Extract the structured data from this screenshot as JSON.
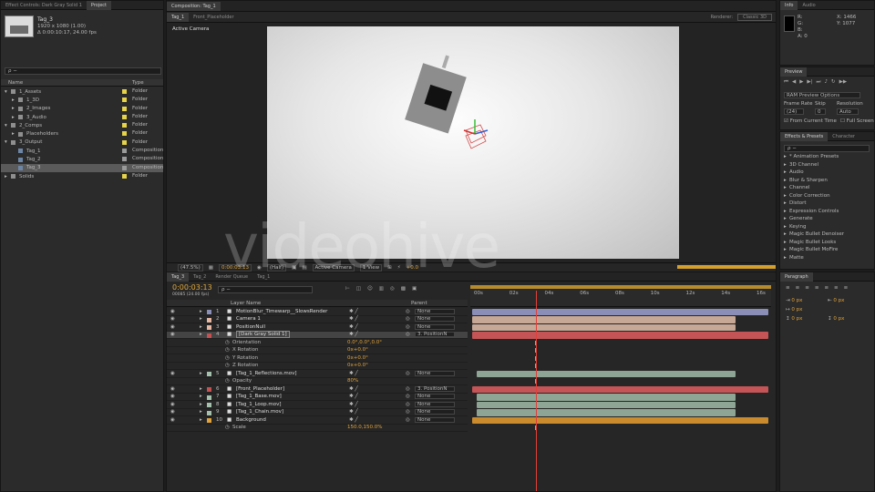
{
  "project": {
    "tabs": [
      "Effect Controls: Dark Gray Solid 1",
      "Project"
    ],
    "comp_name": "Tag_3",
    "comp_info_line1": "1920 x 1080 (1.00)",
    "comp_info_line2": "Δ 0:00:10:17, 24.00 fps",
    "search_placeholder": "ρ −",
    "col_name": "Name",
    "col_type": "Type",
    "items": [
      {
        "name": "1_Assets",
        "type": "Folder",
        "indent": 0,
        "kind": "folder",
        "twirl": "▾"
      },
      {
        "name": "1_3D",
        "type": "Folder",
        "indent": 1,
        "kind": "folder",
        "twirl": "▸"
      },
      {
        "name": "2_Images",
        "type": "Folder",
        "indent": 1,
        "kind": "folder",
        "twirl": "▸"
      },
      {
        "name": "3_Audio",
        "type": "Folder",
        "indent": 1,
        "kind": "folder",
        "twirl": "▸"
      },
      {
        "name": "2_Comps",
        "type": "Folder",
        "indent": 0,
        "kind": "folder",
        "twirl": "▾"
      },
      {
        "name": "Placeholders",
        "type": "Folder",
        "indent": 1,
        "kind": "folder",
        "twirl": "▸"
      },
      {
        "name": "3_Output",
        "type": "Folder",
        "indent": 0,
        "kind": "folder",
        "twirl": "▾"
      },
      {
        "name": "Tag_1",
        "type": "Composition",
        "indent": 1,
        "kind": "comp",
        "twirl": ""
      },
      {
        "name": "Tag_2",
        "type": "Composition",
        "indent": 1,
        "kind": "comp",
        "twirl": ""
      },
      {
        "name": "Tag_3",
        "type": "Composition",
        "indent": 1,
        "kind": "comp",
        "twirl": "",
        "selected": true
      },
      {
        "name": "Solids",
        "type": "Folder",
        "indent": 0,
        "kind": "folder",
        "twirl": "▸"
      }
    ]
  },
  "composition": {
    "tabs": [
      "Composition: Tag_1",
      "Tag_1",
      "Front_Placeholder"
    ],
    "renderer_label": "Renderer:",
    "renderer_value": "Classic 3D",
    "view_label": "Active Camera",
    "zoom": "(47.5%)",
    "timecode": "0:00:03:13",
    "resolution": "(Half)",
    "camera": "Active Camera",
    "views": "1 View",
    "exposure": "+0.0",
    "watermark": "videohive"
  },
  "info": {
    "tabs": [
      "Info",
      "Audio"
    ],
    "r": "R:",
    "g": "G:",
    "b": "B:",
    "a": "A: 0",
    "x": "X: 1466",
    "y": "Y: 1077"
  },
  "preview": {
    "title": "Preview",
    "ram_options": "RAM Preview Options",
    "frame_rate_label": "Frame Rate",
    "skip_label": "Skip",
    "resolution_label": "Resolution",
    "frame_rate": "(24)",
    "skip": "0",
    "resolution": "Auto",
    "from_current": "From Current Time",
    "full_screen": "Full Screen"
  },
  "effects": {
    "tabs": [
      "Effects & Presets",
      "Character"
    ],
    "search_placeholder": "ρ −",
    "items": [
      "* Animation Presets",
      "3D Channel",
      "Audio",
      "Blur & Sharpen",
      "Channel",
      "Color Correction",
      "Distort",
      "Expression Controls",
      "Generate",
      "Keying",
      "Magic Bullet Denoiser",
      "Magic Bullet Looks",
      "Magic Bullet MoFire",
      "Matte"
    ]
  },
  "paragraph": {
    "tabs": [
      "Paragraph"
    ],
    "values": [
      "0 px",
      "0 px",
      "0 px",
      "0 px",
      "0 px"
    ]
  },
  "timeline": {
    "tabs": [
      "Tag_3",
      "Tag_2",
      "Render Queue",
      "Tag_1"
    ],
    "timecode": "0:00:03:13",
    "frames": "00085 (24.00 fps)",
    "search_placeholder": "ρ −",
    "col_source": "Layer Name",
    "col_parent": "Parent",
    "ruler": [
      "00s",
      "02s",
      "04s",
      "06s",
      "08s",
      "10s",
      "12s",
      "14s",
      "16s"
    ],
    "layers": [
      {
        "kind": "layer",
        "num": "1",
        "name": "MotionBlur_Timewarp__SlowsRender",
        "color": "#8a8fb8",
        "parent": "None",
        "bar_start": 0.0,
        "bar_end": 1.0,
        "bar_color": "#8b8fb8"
      },
      {
        "kind": "layer",
        "num": "2",
        "name": "Camera 1",
        "color": "#e6b7a2",
        "parent": "None",
        "bar_start": 0.0,
        "bar_end": 0.89,
        "bar_color": "#c7a896"
      },
      {
        "kind": "layer",
        "num": "3",
        "name": "PositionNull",
        "color": "#e6b7a2",
        "parent": "None",
        "bar_start": 0.0,
        "bar_end": 0.89,
        "bar_color": "#c7a896"
      },
      {
        "kind": "layer",
        "num": "4",
        "name": "[Dark Gray Solid 1]",
        "color": "#c45252",
        "parent": "3. PositionN",
        "bar_start": 0.0,
        "bar_end": 1.0,
        "bar_color": "#c45456",
        "selected": true
      },
      {
        "kind": "prop",
        "name": "Orientation",
        "value": "0.0°,0.0°,0.0°"
      },
      {
        "kind": "prop",
        "name": "X Rotation",
        "value": "0x+0.0°"
      },
      {
        "kind": "prop",
        "name": "Y Rotation",
        "value": "0x+0.0°"
      },
      {
        "kind": "prop",
        "name": "Z Rotation",
        "value": "0x+0.0°"
      },
      {
        "kind": "layer",
        "num": "5",
        "name": "[Tag_1_Reflections.mov]",
        "color": "#a6c0ae",
        "parent": "None",
        "bar_start": 0.015,
        "bar_end": 0.89,
        "bar_color": "#8ea595"
      },
      {
        "kind": "prop",
        "name": "Opacity",
        "value": "80%"
      },
      {
        "kind": "layer",
        "num": "6",
        "name": "[Front_Placeholder]",
        "color": "#c45252",
        "parent": "3. PositionN",
        "bar_start": 0.0,
        "bar_end": 1.0,
        "bar_color": "#c45456"
      },
      {
        "kind": "layer",
        "num": "7",
        "name": "[Tag_1_Base.mov]",
        "color": "#a6c0ae",
        "parent": "None",
        "bar_start": 0.015,
        "bar_end": 0.89,
        "bar_color": "#8ea595"
      },
      {
        "kind": "layer",
        "num": "8",
        "name": "[Tag_1_Loop.mov]",
        "color": "#a6c0ae",
        "parent": "None",
        "bar_start": 0.015,
        "bar_end": 0.89,
        "bar_color": "#8ea595"
      },
      {
        "kind": "layer",
        "num": "9",
        "name": "[Tag_1_Chain.mov]",
        "color": "#a6c0ae",
        "parent": "None",
        "bar_start": 0.015,
        "bar_end": 0.89,
        "bar_color": "#8ea595"
      },
      {
        "kind": "layer",
        "num": "10",
        "name": "Background",
        "color": "#e0a23a",
        "parent": "None",
        "bar_start": 0.0,
        "bar_end": 1.0,
        "bar_color": "#c98b2d"
      },
      {
        "kind": "prop",
        "name": "Scale",
        "value": "150.0,150.0%"
      }
    ],
    "playhead": 0.215
  }
}
